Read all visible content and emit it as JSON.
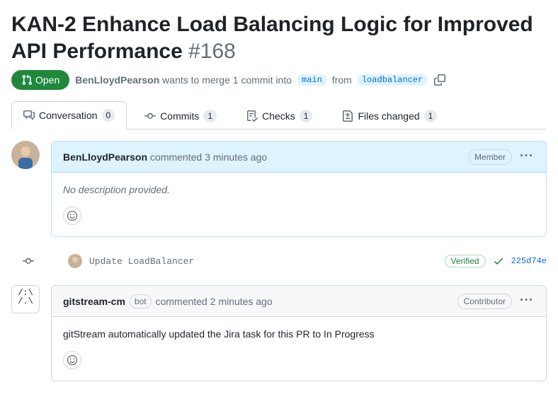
{
  "pr": {
    "title": "KAN-2 Enhance Load Balancing Logic for Improved API Performance",
    "number": "#168",
    "state": "Open",
    "author": "BenLloydPearson",
    "merge_text_pre": "wants to merge 1 commit into",
    "base_branch": "main",
    "merge_text_mid": "from",
    "head_branch": "loadbalancer"
  },
  "tabs": {
    "conversation": {
      "label": "Conversation",
      "count": "0"
    },
    "commits": {
      "label": "Commits",
      "count": "1"
    },
    "checks": {
      "label": "Checks",
      "count": "1"
    },
    "files": {
      "label": "Files changed",
      "count": "1"
    }
  },
  "comments": [
    {
      "author": "BenLloydPearson",
      "action": "commented",
      "time": "3 minutes ago",
      "role": "Member",
      "body_placeholder": "No description provided."
    },
    {
      "author": "gitstream-cm",
      "is_bot": true,
      "bot_label": "bot",
      "action": "commented",
      "time": "2 minutes ago",
      "role": "Contributor",
      "body": "gitStream automatically updated the Jira task for this PR to In Progress"
    }
  ],
  "commit_event": {
    "message": "Update LoadBalancer",
    "verified": "Verified",
    "sha": "225d74e"
  }
}
